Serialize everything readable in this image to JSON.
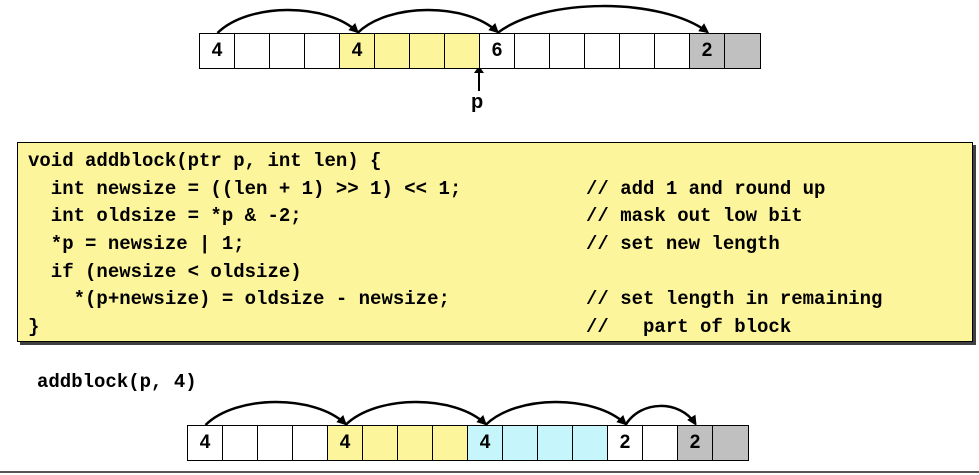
{
  "heap_before": {
    "cells": [
      {
        "text": "4",
        "color": "white"
      },
      {
        "text": "",
        "color": "white"
      },
      {
        "text": "",
        "color": "white"
      },
      {
        "text": "",
        "color": "white"
      },
      {
        "text": "4",
        "color": "yellow"
      },
      {
        "text": "",
        "color": "yellow"
      },
      {
        "text": "",
        "color": "yellow"
      },
      {
        "text": "",
        "color": "yellow"
      },
      {
        "text": "6",
        "color": "white"
      },
      {
        "text": "",
        "color": "white"
      },
      {
        "text": "",
        "color": "white"
      },
      {
        "text": "",
        "color": "white"
      },
      {
        "text": "",
        "color": "white"
      },
      {
        "text": "",
        "color": "white"
      },
      {
        "text": "2",
        "color": "gray"
      },
      {
        "text": "",
        "color": "gray"
      }
    ],
    "arrows": [
      [
        0,
        4
      ],
      [
        4,
        8
      ],
      [
        8,
        14
      ]
    ],
    "pointer_label": "p",
    "pointer_cell": 8
  },
  "code": {
    "lines": [
      {
        "code": "void addblock(ptr p, int len) {",
        "comment": ""
      },
      {
        "code": "  int newsize = ((len + 1) >> 1) << 1;",
        "comment": "// add 1 and round up"
      },
      {
        "code": "  int oldsize = *p & -2;",
        "comment": "// mask out low bit"
      },
      {
        "code": "  *p = newsize | 1;",
        "comment": "// set new length"
      },
      {
        "code": "  if (newsize < oldsize)",
        "comment": ""
      },
      {
        "code": "    *(p+newsize) = oldsize - newsize;",
        "comment": "// set length in remaining"
      },
      {
        "code": "}",
        "comment": "//   part of block"
      }
    ]
  },
  "call_label": "addblock(p, 4)",
  "heap_after": {
    "cells": [
      {
        "text": "4",
        "color": "white"
      },
      {
        "text": "",
        "color": "white"
      },
      {
        "text": "",
        "color": "white"
      },
      {
        "text": "",
        "color": "white"
      },
      {
        "text": "4",
        "color": "yellow"
      },
      {
        "text": "",
        "color": "yellow"
      },
      {
        "text": "",
        "color": "yellow"
      },
      {
        "text": "",
        "color": "yellow"
      },
      {
        "text": "4",
        "color": "cyan"
      },
      {
        "text": "",
        "color": "cyan"
      },
      {
        "text": "",
        "color": "cyan"
      },
      {
        "text": "",
        "color": "cyan"
      },
      {
        "text": "2",
        "color": "white"
      },
      {
        "text": "",
        "color": "white"
      },
      {
        "text": "2",
        "color": "gray"
      },
      {
        "text": "",
        "color": "gray"
      }
    ],
    "arrows": [
      [
        0,
        4
      ],
      [
        4,
        8
      ],
      [
        8,
        12
      ],
      [
        12,
        14
      ]
    ]
  },
  "colors": {
    "white": "#ffffff",
    "yellow": "#fdf59b",
    "cyan": "#c7f5fc",
    "gray": "#c0c0c0"
  }
}
